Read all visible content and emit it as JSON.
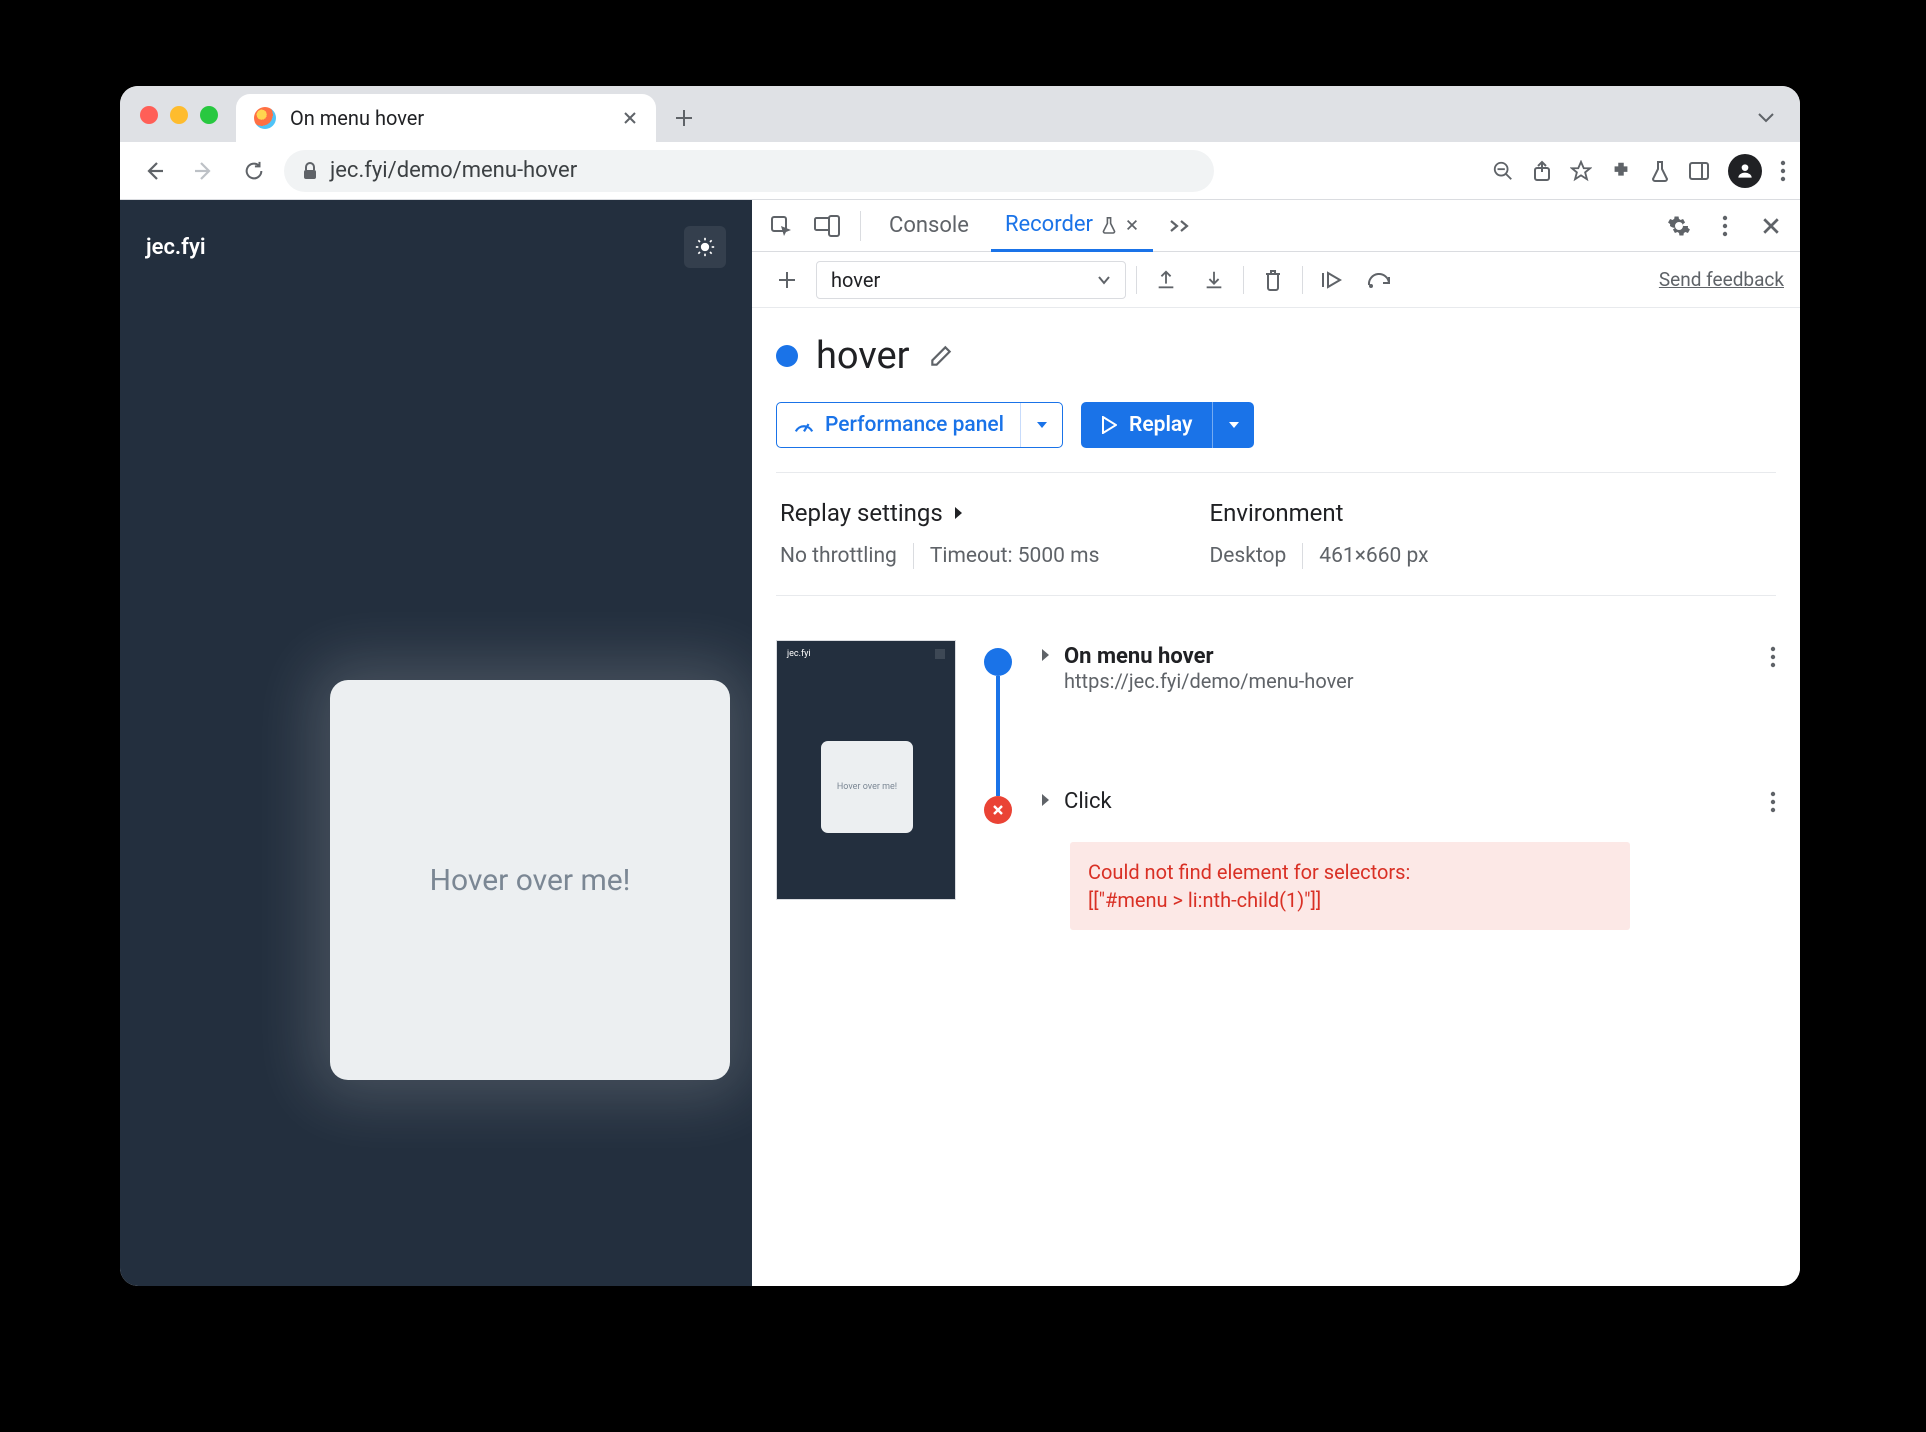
{
  "browser": {
    "tab_title": "On menu hover",
    "url": "jec.fyi/demo/menu-hover"
  },
  "page": {
    "site_title": "jec.fyi",
    "hover_card_text": "Hover over me!",
    "thumb_text": "Hover over me!"
  },
  "devtools": {
    "tabs": {
      "console": "Console",
      "recorder": "Recorder"
    },
    "recorder": {
      "add_tooltip": "New recording",
      "selected_recording": "hover",
      "send_feedback": "Send feedback",
      "title": "hover",
      "perf_panel_label": "Performance panel",
      "replay_label": "Replay",
      "settings": {
        "replay_header": "Replay settings",
        "throttling": "No throttling",
        "timeout": "Timeout: 5000 ms",
        "env_header": "Environment",
        "device": "Desktop",
        "dimensions": "461×660 px"
      },
      "steps": {
        "nav_title": "On menu hover",
        "nav_url": "https://jec.fyi/demo/menu-hover",
        "click_title": "Click",
        "error_line1": "Could not find element for selectors:",
        "error_line2": "[[\"#menu > li:nth-child(1)\"]]"
      }
    }
  }
}
